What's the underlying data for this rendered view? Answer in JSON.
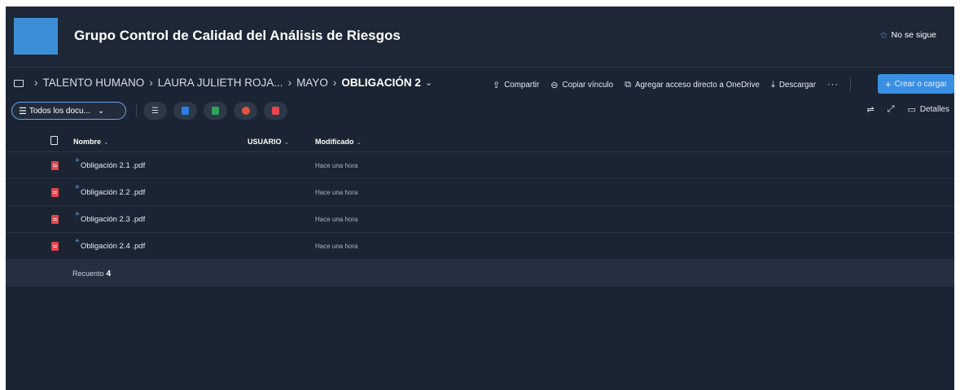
{
  "site": {
    "title": "Grupo Control de Calidad del Análisis de Riesgos",
    "follow_label": "No se sigue",
    "logo_color": "#3c8fd6"
  },
  "breadcrumb": {
    "items": [
      "TALENTO HUMANO",
      "LAURA JULIETH ROJA...",
      "MAYO"
    ],
    "current": "OBLIGACIÓN 2"
  },
  "actions": {
    "share": "Compartir",
    "copy_link": "Copiar vínculo",
    "add_shortcut": "Agregar acceso directo a OneDrive",
    "download": "Descargar",
    "more": "···",
    "create": "Crear o cargar"
  },
  "toolbar": {
    "view_label": "Todos los docu...",
    "details": "Detalles"
  },
  "table": {
    "columns": {
      "name": "Nombre",
      "user": "USUARIO",
      "modified": "Modificado"
    },
    "rows": [
      {
        "name": "Obligación 2.1 .pdf",
        "modified": "Hace una hora"
      },
      {
        "name": "Obligación 2.2 .pdf",
        "modified": "Hace una hora"
      },
      {
        "name": "Obligación 2.3 .pdf",
        "modified": "Hace una hora"
      },
      {
        "name": "Obligación 2.4 .pdf",
        "modified": "Hace una hora"
      }
    ],
    "count_label": "Recuento",
    "count": "4"
  },
  "colors": {
    "background": "#1b2432",
    "accent": "#3a8fe3",
    "pdf": "#e8454e"
  }
}
